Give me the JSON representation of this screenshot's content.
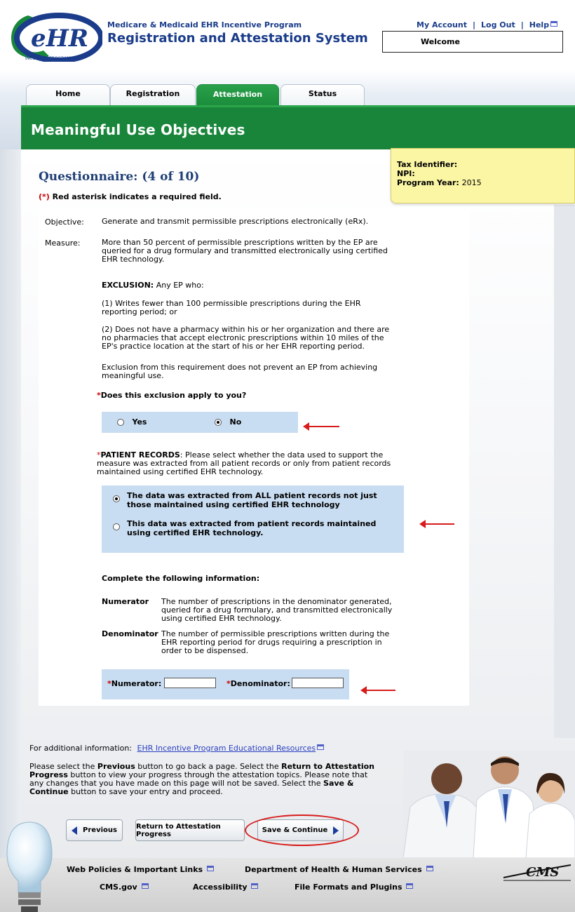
{
  "header": {
    "logo_text": "eHR",
    "logo_sub": "INCENTIVE PROGRAM",
    "program_subtitle": "Medicare & Medicaid EHR Incentive Program",
    "program_title": "Registration and Attestation System",
    "links": {
      "my_account": "My Account",
      "log_out": "Log Out",
      "help": "Help"
    },
    "welcome": "Welcome"
  },
  "tabs": [
    {
      "label": "Home"
    },
    {
      "label": "Registration"
    },
    {
      "label": "Attestation"
    },
    {
      "label": "Status"
    }
  ],
  "banner_title": "Meaningful Use Objectives",
  "tax_box": {
    "tax_label": "Tax Identifier:",
    "npi_label": "NPI:",
    "year_label": "Program Year:",
    "year_value": "2015"
  },
  "questionnaire": {
    "heading": "Questionnaire: (4 of 10)",
    "req_star": "(*)",
    "req_text": " Red asterisk indicates a required field.",
    "objective_label": "Objective:",
    "objective_text": "Generate and transmit permissible prescriptions electronically (eRx).",
    "measure_label": "Measure:",
    "measure_text": "More than 50 percent of permissible prescriptions written by the EP are queried for a drug formulary and transmitted electronically using certified EHR technology.",
    "exclusion_label": "EXCLUSION:",
    "exclusion_text": " Any EP who:",
    "exclusion_1": "(1) Writes fewer than 100 permissible prescriptions during the EHR reporting period; or",
    "exclusion_2": "(2) Does not have a pharmacy within his or her organization and there are no pharmacies that accept electronic prescriptions within 10 miles of the EP's practice location at the start of his or her EHR reporting period.",
    "exclusion_note": "Exclusion from this requirement does not prevent an EP from achieving meaningful use.",
    "star": "*",
    "exclusion_question": "Does this exclusion apply to you?",
    "yes_label": "Yes",
    "no_label": "No",
    "patient_records_label": "PATIENT RECORDS",
    "patient_records_text": ": Please select whether the data used to support the measure was extracted from all patient records or only from patient records maintained using certified EHR technology.",
    "option_all": "The data was extracted from ALL patient records not just those maintained using certified EHR technology",
    "option_certified": "This data was extracted from patient records maintained using certified EHR technology.",
    "complete_heading": "Complete the following information:",
    "numerator_label": "Numerator",
    "numerator_desc": "The number of prescriptions in the denominator generated, queried for a drug formulary, and transmitted electronically using certified EHR technology.",
    "denominator_label": "Denominator",
    "denominator_desc": "The number of permissible prescriptions written during the EHR reporting period for drugs requiring a prescription in order to be dispensed.",
    "numerator_field_label": "Numerator:",
    "denominator_field_label": "Denominator:",
    "numerator_value": "",
    "denominator_value": ""
  },
  "additional_info": {
    "label": "For additional information:",
    "link": "EHR Incentive Program Educational Resources"
  },
  "instructions": {
    "p1": "Please select the ",
    "b1": "Previous",
    "p2": " button to go back a page. Select the ",
    "b2": "Return to Attestation Progress",
    "p3": " button to view your progress through the attestation topics. Please note that any changes that you have made on this page will not be saved. Select the ",
    "b3": "Save & Continue",
    "p4": " button to save your entry and proceed."
  },
  "buttons": {
    "previous": "Previous",
    "return": "Return to Attestation Progress",
    "save": "Save & Continue"
  },
  "footer": {
    "web_policies": "Web Policies & Important Links",
    "hhs": "Department of Health & Human Services",
    "cms_gov": "CMS.gov",
    "accessibility": "Accessibility",
    "file_formats": "File Formats and Plugins",
    "cms_logo": "CMS"
  },
  "colors": {
    "banner_green": "#18853a",
    "title_blue": "#1a3c8a",
    "answer_blue": "#c9ddf2",
    "tax_yellow": "#fbf6a4",
    "annotation_red": "#d81c1c"
  }
}
